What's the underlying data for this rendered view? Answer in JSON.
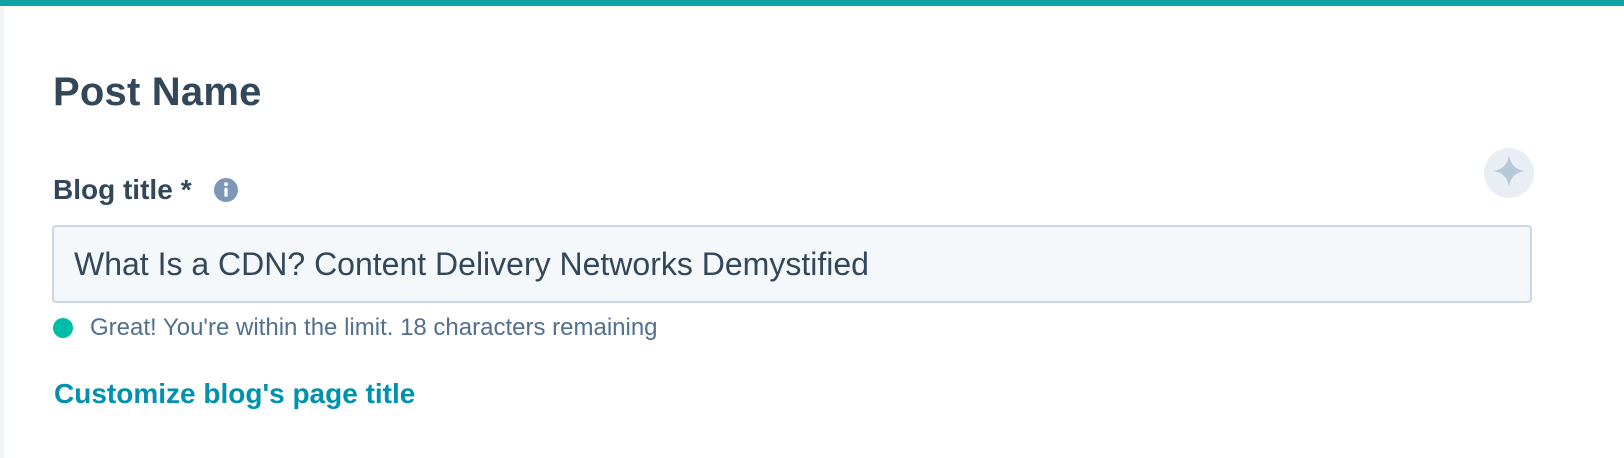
{
  "colors": {
    "top_accent": "#0fa3a3",
    "heading_text": "#33475b",
    "input_background": "#f5f8fa",
    "input_border": "#cbd6e2",
    "success_dot": "#00bda5",
    "helper_text": "#516f90",
    "link": "#0091ae",
    "ai_button_background": "#e8eef4",
    "ai_icon": "#b8c8d8",
    "info_icon": "#7c98b6"
  },
  "section": {
    "title": "Post Name"
  },
  "blog_title_field": {
    "label": "Blog title",
    "required_mark": "*",
    "info_icon": "info-icon",
    "value": "What Is a CDN? Content Delivery Networks Demystified",
    "validation_message": "Great! You're within the limit. 18 characters remaining",
    "validation_status": "success",
    "ai_assist_icon": "sparkle-icon"
  },
  "links": {
    "customize_page_title": "Customize blog's page title"
  }
}
